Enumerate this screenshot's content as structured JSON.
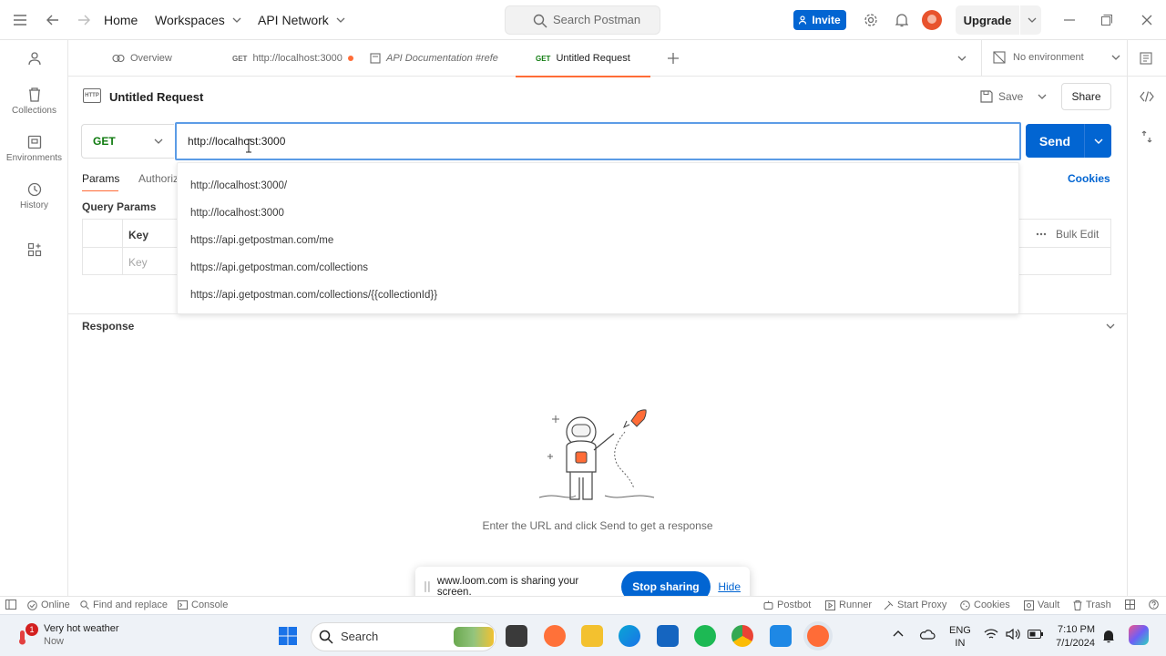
{
  "topbar": {
    "nav": [
      "Home",
      "Workspaces",
      "API Network"
    ],
    "search_placeholder": "Search Postman",
    "invite_label": "Invite",
    "upgrade_label": "Upgrade"
  },
  "sidebar": {
    "items": [
      {
        "label": "",
        "icon": "user-icon"
      },
      {
        "label": "Collections",
        "icon": "trash-can-icon"
      },
      {
        "label": "Environments",
        "icon": "environment-icon"
      },
      {
        "label": "History",
        "icon": "history-icon"
      },
      {
        "label": "",
        "icon": "add-workspace-icon"
      }
    ]
  },
  "tabs": [
    {
      "label": "Overview",
      "method": ""
    },
    {
      "label": "http://localhost:3000",
      "method": "GET",
      "unsaved": true
    },
    {
      "label": "API Documentation #refe",
      "method": ""
    },
    {
      "label": "Untitled Request",
      "method": "GET",
      "active": true
    }
  ],
  "environment": {
    "label": "No environment"
  },
  "request": {
    "title": "Untitled Request",
    "http_badge": "HTTP",
    "save_label": "Save",
    "share_label": "Share",
    "method": "GET",
    "url": "http://localhost:3000",
    "send_label": "Send"
  },
  "subtabs": {
    "params": "Params",
    "authorization": "Authoriz",
    "cookies": "Cookies"
  },
  "query_params": {
    "title": "Query Params",
    "key_header": "Key",
    "key_placeholder": "Key",
    "bulk_edit": "Bulk Edit"
  },
  "suggestions": [
    "http://localhost:3000/",
    "http://localhost:3000",
    "https://api.getpostman.com/me",
    "https://api.getpostman.com/collections",
    "https://api.getpostman.com/collections/{{collectionId}}"
  ],
  "response": {
    "title": "Response",
    "hint": "Enter the URL and click Send to get a response"
  },
  "loom": {
    "message": "www.loom.com is sharing your screen.",
    "stop_label": "Stop sharing",
    "hide_label": "Hide"
  },
  "statusbar": {
    "online": "Online",
    "find_replace": "Find and replace",
    "console": "Console",
    "postbot": "Postbot",
    "runner": "Runner",
    "start_proxy": "Start Proxy",
    "cookies": "Cookies",
    "vault": "Vault",
    "trash": "Trash"
  },
  "taskbar": {
    "weather_title": "Very hot weather",
    "weather_sub": "Now",
    "weather_badge": "1",
    "search_label": "Search",
    "lang_top": "ENG",
    "lang_bottom": "IN",
    "time": "7:10 PM",
    "date": "7/1/2024"
  },
  "colors": {
    "brand_orange": "#ff6c37",
    "primary_blue": "#0265d2",
    "get_green": "#0f7b0f"
  }
}
